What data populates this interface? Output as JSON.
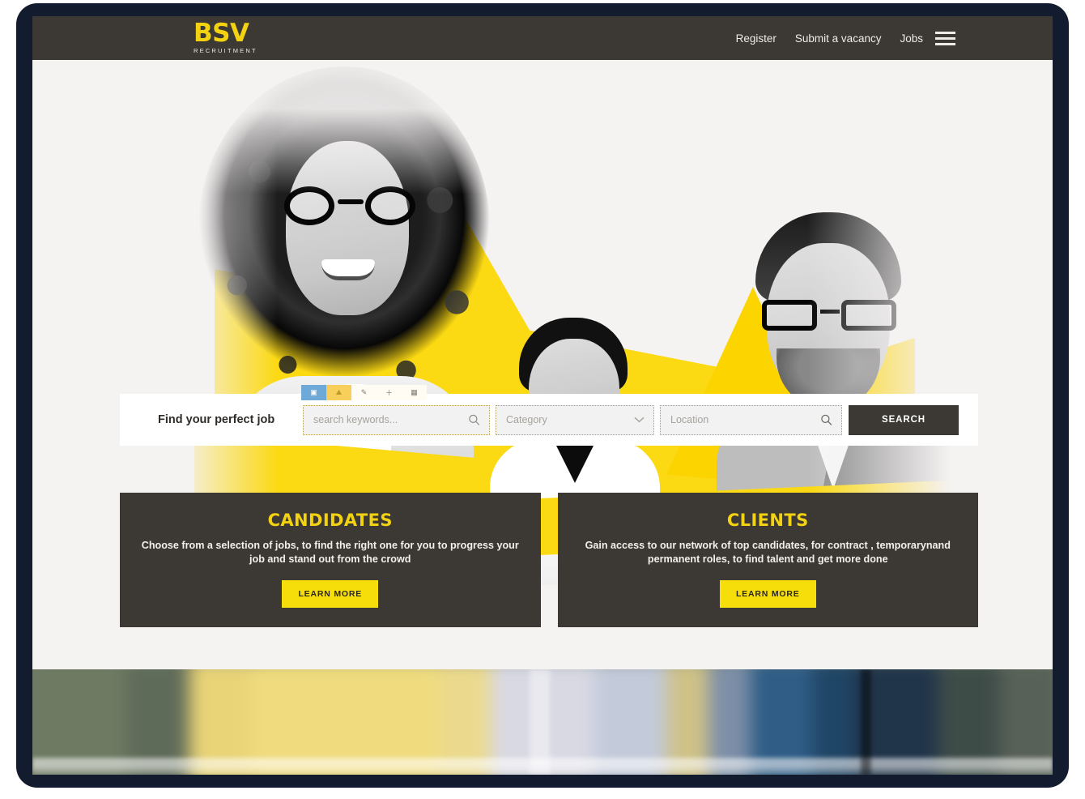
{
  "site": {
    "logo_mark": "BSV",
    "logo_sub": "RECRUITMENT"
  },
  "header": {
    "nav": [
      {
        "label": "Register"
      },
      {
        "label": "Submit a vacancy"
      },
      {
        "label": "Jobs"
      }
    ],
    "menu_icon": "hamburger-menu-icon"
  },
  "editor_toolbar": {
    "buttons": [
      {
        "icon": "image-placeholder-icon",
        "glyph": "ὛC",
        "state": "selected"
      },
      {
        "icon": "broken-image-icon",
        "glyph": "⛰",
        "state": "warning"
      },
      {
        "icon": "edit-pencil-icon",
        "glyph": "✎",
        "state": "plain"
      },
      {
        "icon": "add-plus-icon",
        "glyph": "＋",
        "state": "plain"
      },
      {
        "icon": "gallery-icon",
        "glyph": "⊞",
        "state": "plain"
      }
    ]
  },
  "search": {
    "title": "Find your perfect job",
    "keywords_placeholder": "search keywords...",
    "keywords_value": "",
    "keywords_icon": "search-icon",
    "category_placeholder": "Category",
    "category_value": "",
    "category_icon": "chevron-down-icon",
    "category_options": [
      "Category"
    ],
    "location_placeholder": "Location",
    "location_value": "",
    "location_icon": "search-icon",
    "submit_label": "SEARCH"
  },
  "promos": [
    {
      "title": "CANDIDATES",
      "text": "Choose from a selection of jobs, to find the right one for you to progress your job and stand out from the crowd",
      "button_label": "LEARN MORE"
    },
    {
      "title": "CLIENTS",
      "text": "Gain access to our network of top candidates, for contract , temporarynand permanent roles, to find talent and get more done",
      "button_label": "LEARN MORE"
    }
  ],
  "colors": {
    "brand_yellow": "#f3d211",
    "button_yellow": "#f6de0b",
    "dark": "#3c3833",
    "page_bg": "#f5f2f2",
    "frame": "#131c2e"
  }
}
